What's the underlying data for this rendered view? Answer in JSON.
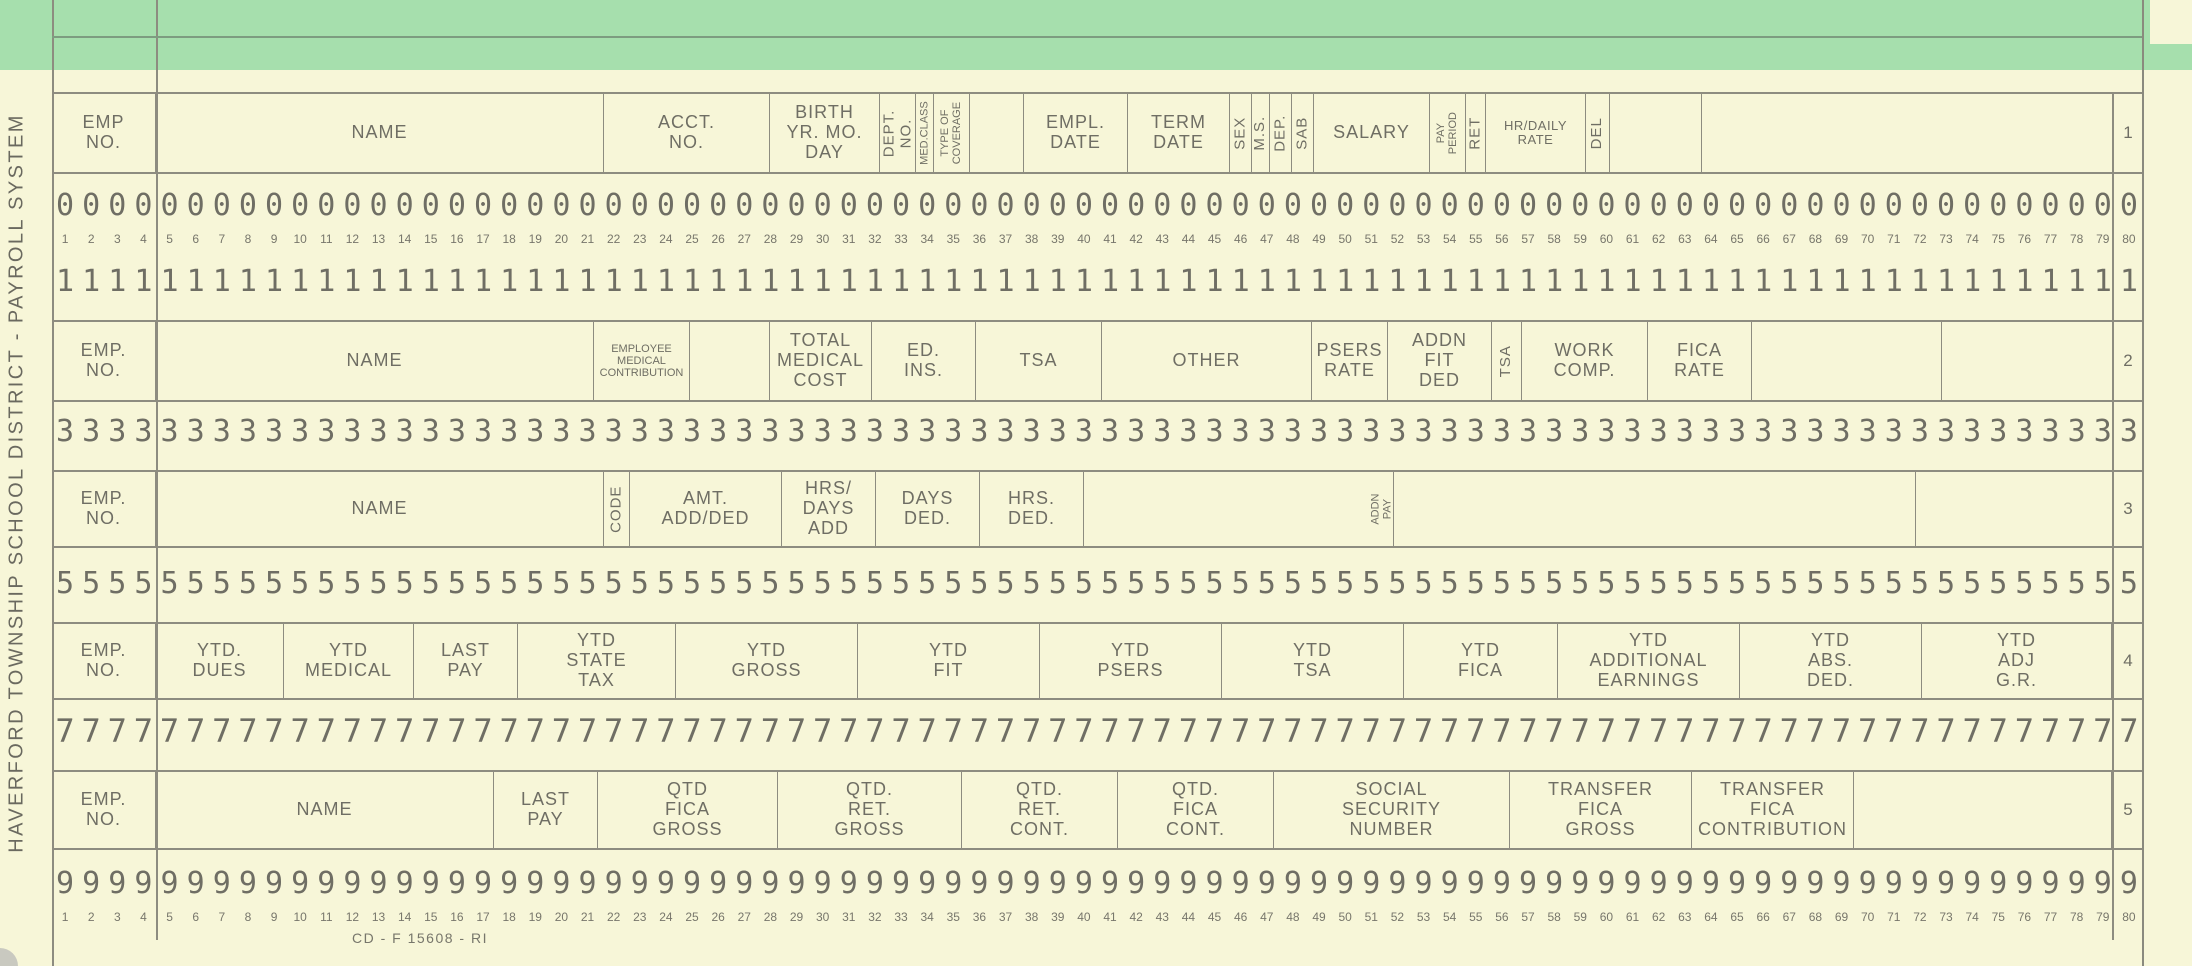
{
  "side_title": "HAVERFORD TOWNSHIP SCHOOL DISTRICT - PAYROLL SYSTEM",
  "form_number": "CD - F 15608 - RI",
  "rows": [
    {
      "row_number": "1",
      "cells": [
        {
          "label": "EMP\nNO."
        },
        {
          "label": "NAME"
        },
        {
          "label": "ACCT.\nNO."
        },
        {
          "label": "BIRTH\nYR. MO. DAY"
        },
        {
          "label": "DEPT.\nNO."
        },
        {
          "label": "MED.CLASS"
        },
        {
          "label": "TYPE OF\nCOVERAGE"
        },
        {
          "label": ""
        },
        {
          "label": "EMPL.\nDATE"
        },
        {
          "label": "TERM\nDATE"
        },
        {
          "label": "SEX"
        },
        {
          "label": "M.S."
        },
        {
          "label": "DEP."
        },
        {
          "label": "SAB"
        },
        {
          "label": "SALARY"
        },
        {
          "label": "PAY\nPERIOD"
        },
        {
          "label": "RET"
        },
        {
          "label": "HR/DAILY\nRATE"
        },
        {
          "label": "DEL"
        },
        {
          "label": ""
        }
      ]
    },
    {
      "row_number": "2",
      "cells": [
        {
          "label": "EMP.\nNO."
        },
        {
          "label": "NAME"
        },
        {
          "label": "EMPLOYEE\nMEDICAL\nCONTRIBUTION"
        },
        {
          "label": ""
        },
        {
          "label": "TOTAL\nMEDICAL\nCOST"
        },
        {
          "label": "ED.\nINS."
        },
        {
          "label": "TSA"
        },
        {
          "label": "OTHER"
        },
        {
          "label": "PSERS\nRATE"
        },
        {
          "label": "ADDN\nFIT\nDED"
        },
        {
          "label": "TSA"
        },
        {
          "label": "WORK\nCOMP."
        },
        {
          "label": "FICA\nRATE"
        },
        {
          "label": ""
        }
      ]
    },
    {
      "row_number": "3",
      "cells": [
        {
          "label": "EMP.\nNO."
        },
        {
          "label": "NAME"
        },
        {
          "label": "CODE"
        },
        {
          "label": "AMT.\nADD/DED"
        },
        {
          "label": "HRS/\nDAYS\nADD"
        },
        {
          "label": "DAYS\nDED."
        },
        {
          "label": "HRS.\nDED."
        },
        {
          "label": ""
        },
        {
          "label": "ADDN PAY"
        },
        {
          "label": ""
        }
      ]
    },
    {
      "row_number": "4",
      "cells": [
        {
          "label": "EMP.\nNO."
        },
        {
          "label": "YTD.\nDUES"
        },
        {
          "label": "YTD\nMEDICAL"
        },
        {
          "label": "LAST\nPAY"
        },
        {
          "label": "YTD\nSTATE\nTAX"
        },
        {
          "label": "YTD\nGROSS"
        },
        {
          "label": "YTD\nFIT"
        },
        {
          "label": "YTD\nPSERS"
        },
        {
          "label": "YTD\nTSA"
        },
        {
          "label": "YTD\nFICA"
        },
        {
          "label": "YTD\nADDITIONAL\nEARNINGS"
        },
        {
          "label": "YTD\nABS.\nDED."
        },
        {
          "label": "YTD\nADJ\nG.R."
        }
      ]
    },
    {
      "row_number": "5",
      "cells": [
        {
          "label": "EMP.\nNO."
        },
        {
          "label": "NAME"
        },
        {
          "label": "LAST\nPAY"
        },
        {
          "label": "QTD\nFICA\nGROSS"
        },
        {
          "label": "QTD.\nRET.\nGROSS"
        },
        {
          "label": "QTD.\nRET.\nCONT."
        },
        {
          "label": "QTD.\nFICA\nCONT."
        },
        {
          "label": "SOCIAL\nSECURITY\nNUMBER"
        },
        {
          "label": "TRANSFER\nFICA\nGROSS"
        },
        {
          "label": "TRANSFER\nFICA\nCONTRIBUTION"
        },
        {
          "label": ""
        }
      ]
    }
  ],
  "digit_rows": [
    "0",
    "1",
    "3",
    "5",
    "7",
    "9"
  ],
  "column_count": 80
}
